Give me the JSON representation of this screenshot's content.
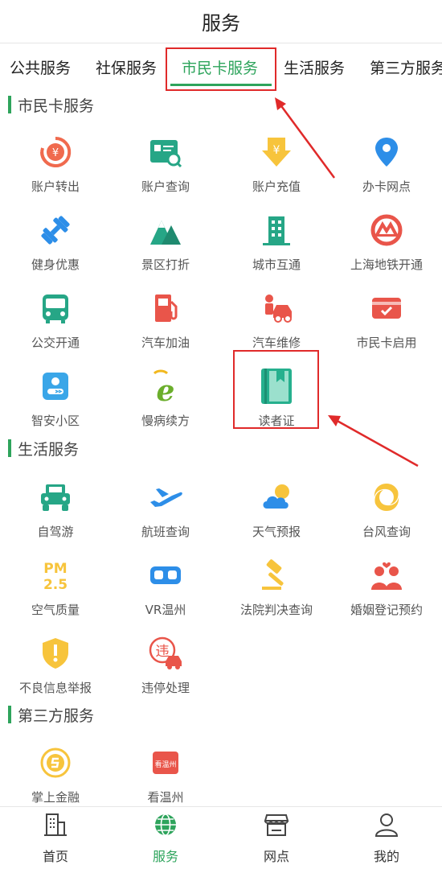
{
  "header": {
    "title": "服务"
  },
  "tabs": [
    {
      "label": "公共服务"
    },
    {
      "label": "社保服务"
    },
    {
      "label": "市民卡服务"
    },
    {
      "label": "生活服务"
    },
    {
      "label": "第三方服务"
    }
  ],
  "active_tab": "市民卡服务",
  "sections": {
    "citizen_card": {
      "title": "市民卡服务",
      "items": [
        {
          "label": "账户转出",
          "icon": "transfer-out-icon"
        },
        {
          "label": "账户查询",
          "icon": "account-query-icon"
        },
        {
          "label": "账户充值",
          "icon": "recharge-icon"
        },
        {
          "label": "办卡网点",
          "icon": "location-pin-icon"
        },
        {
          "label": "健身优惠",
          "icon": "dumbbell-icon"
        },
        {
          "label": "景区打折",
          "icon": "mountain-icon"
        },
        {
          "label": "城市互通",
          "icon": "building-icon"
        },
        {
          "label": "上海地铁开通",
          "icon": "shanghai-metro-icon"
        },
        {
          "label": "公交开通",
          "icon": "bus-icon"
        },
        {
          "label": "汽车加油",
          "icon": "fuel-pump-icon"
        },
        {
          "label": "汽车维修",
          "icon": "car-repair-icon"
        },
        {
          "label": "市民卡启用",
          "icon": "card-activate-icon"
        },
        {
          "label": "智安小区",
          "icon": "smart-community-icon"
        },
        {
          "label": "慢病续方",
          "icon": "e-logo-icon"
        },
        {
          "label": "读者证",
          "icon": "book-icon"
        }
      ]
    },
    "life": {
      "title": "生活服务",
      "items": [
        {
          "label": "自驾游",
          "icon": "jeep-icon"
        },
        {
          "label": "航班查询",
          "icon": "airplane-icon"
        },
        {
          "label": "天气预报",
          "icon": "weather-icon"
        },
        {
          "label": "台风查询",
          "icon": "typhoon-icon"
        },
        {
          "label": "空气质量",
          "icon": "pm25-icon",
          "icon_text": [
            "PM",
            "2.5"
          ]
        },
        {
          "label": "VR温州",
          "icon": "vr-goggles-icon"
        },
        {
          "label": "法院判决查询",
          "icon": "gavel-icon"
        },
        {
          "label": "婚姻登记预约",
          "icon": "couple-icon"
        },
        {
          "label": "不良信息举报",
          "icon": "shield-alert-icon"
        },
        {
          "label": "违停处理",
          "icon": "parking-violation-icon",
          "icon_text": "违"
        }
      ]
    },
    "third_party": {
      "title": "第三方服务",
      "items": [
        {
          "label": "掌上金融",
          "icon": "finance-coin-icon"
        },
        {
          "label": "看温州",
          "icon": "kan-wenzhou-icon",
          "icon_text": "看温州"
        }
      ]
    }
  },
  "bottom_nav": [
    {
      "label": "首页",
      "icon": "home-building-icon"
    },
    {
      "label": "服务",
      "icon": "globe-icon",
      "active": true
    },
    {
      "label": "网点",
      "icon": "store-icon"
    },
    {
      "label": "我的",
      "icon": "user-icon"
    }
  ],
  "colors": {
    "accent": "#2ea45c",
    "annotation": "#e02a2a"
  }
}
